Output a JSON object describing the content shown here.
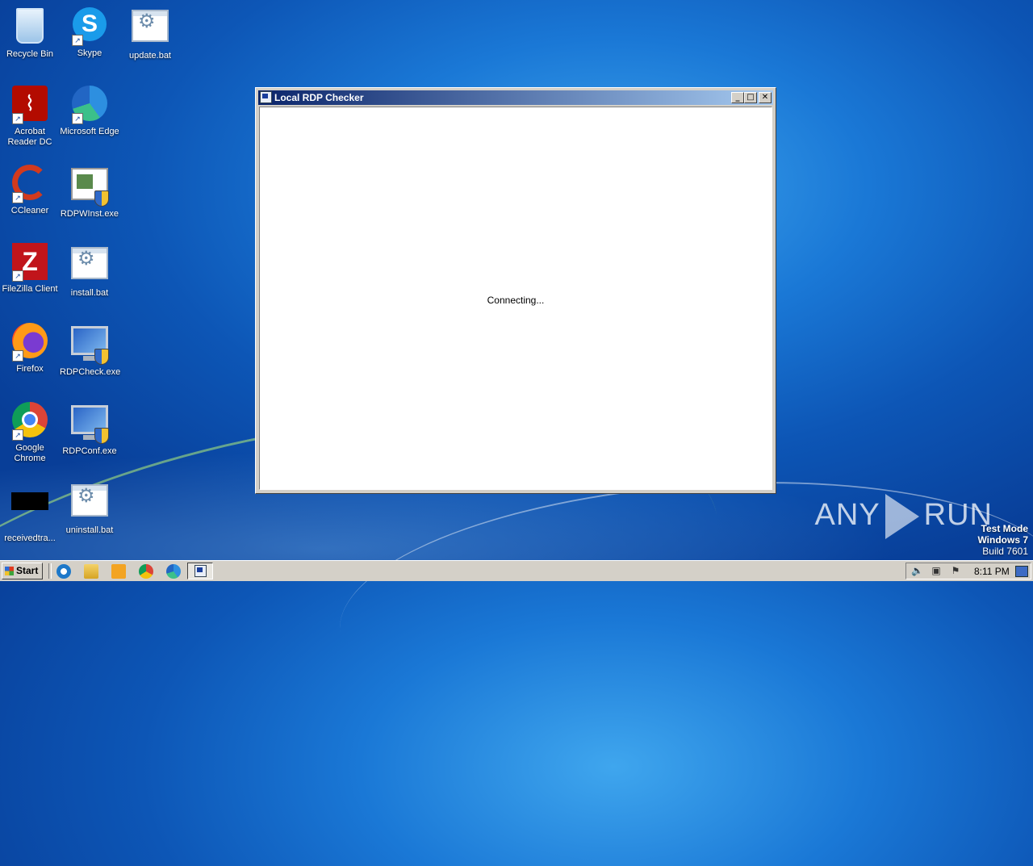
{
  "desktop": {
    "icons": [
      {
        "label": "Recycle Bin",
        "icon": "recycle-bin-icon"
      },
      {
        "label": "Skype",
        "icon": "skype-icon"
      },
      {
        "label": "update.bat",
        "icon": "batch-file-icon"
      },
      {
        "label": "Acrobat Reader DC",
        "icon": "acrobat-icon"
      },
      {
        "label": "Microsoft Edge",
        "icon": "edge-icon"
      },
      {
        "label": "CCleaner",
        "icon": "ccleaner-icon"
      },
      {
        "label": "RDPWInst.exe",
        "icon": "installer-icon"
      },
      {
        "label": "FileZilla Client",
        "icon": "filezilla-icon"
      },
      {
        "label": "install.bat",
        "icon": "batch-file-icon"
      },
      {
        "label": "Firefox",
        "icon": "firefox-icon"
      },
      {
        "label": "RDPCheck.exe",
        "icon": "rdp-monitor-icon"
      },
      {
        "label": "Google Chrome",
        "icon": "chrome-icon"
      },
      {
        "label": "RDPConf.exe",
        "icon": "rdp-monitor-icon"
      },
      {
        "label": "receivedtra...",
        "icon": "black-file-icon"
      },
      {
        "label": "uninstall.bat",
        "icon": "batch-file-icon"
      }
    ]
  },
  "window": {
    "title": "Local RDP Checker",
    "status_text": "Connecting...",
    "buttons": {
      "minimize": "_",
      "maximize": "□",
      "close": "✕"
    }
  },
  "watermark": {
    "left": "ANY",
    "right": "RUN"
  },
  "sysinfo": {
    "line1": "Test Mode",
    "line2": "Windows 7",
    "line3": "Build 7601"
  },
  "taskbar": {
    "start_label": "Start",
    "clock": "8:11 PM",
    "quicklaunch": [
      "internet-explorer-icon",
      "file-explorer-icon",
      "media-player-icon",
      "chrome-icon",
      "edge-icon"
    ],
    "tray_icons": [
      "speaker-icon",
      "network-icon",
      "action-center-flag-icon"
    ]
  }
}
